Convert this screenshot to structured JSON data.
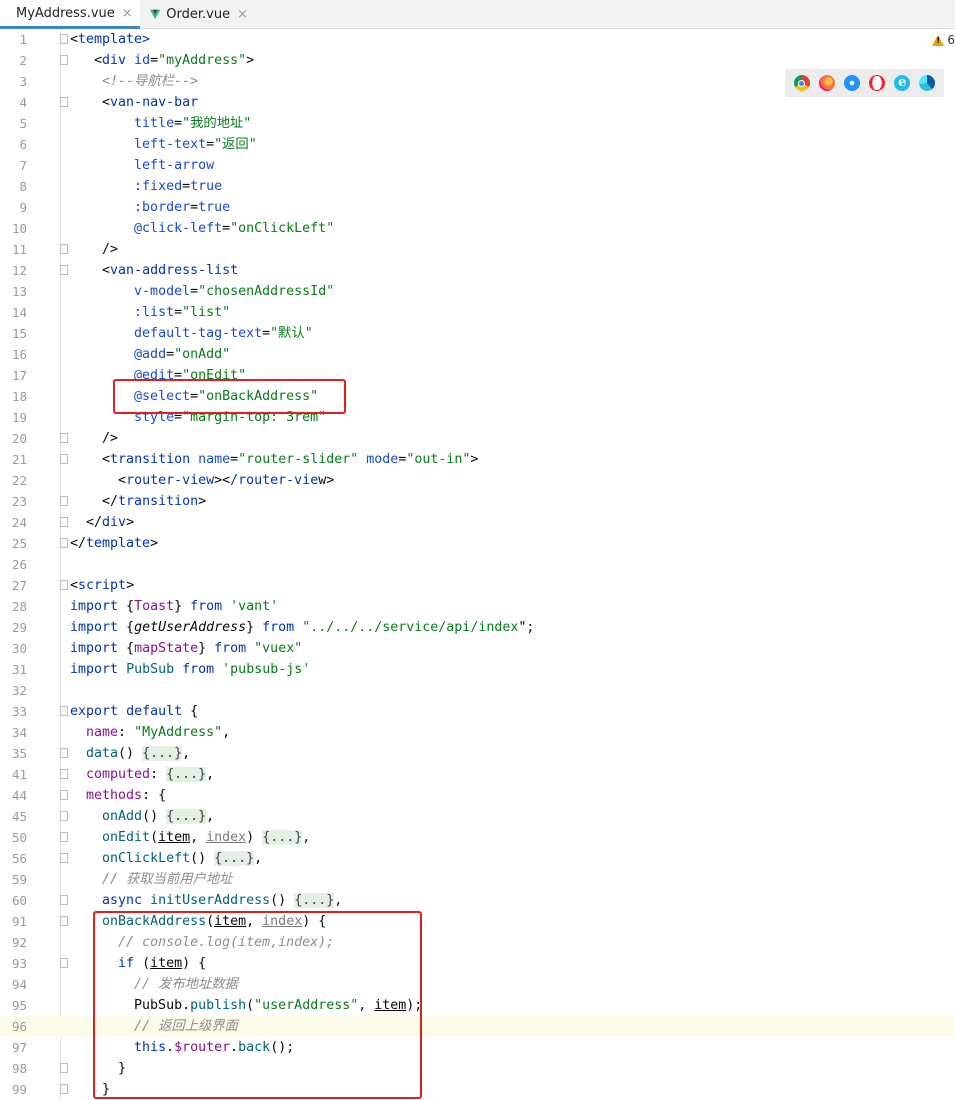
{
  "tabs": [
    {
      "label": "MyAddress.vue",
      "close": "×"
    },
    {
      "label": "Order.vue",
      "close": "×"
    }
  ],
  "warning_count": "6",
  "browser_icons": [
    "chrome-icon",
    "firefox-icon",
    "safari-icon",
    "opera-icon",
    "ie-icon",
    "edge-icon"
  ],
  "colors": {
    "accent": "#4083c9",
    "highlight_box": "#e0201f",
    "vue_logo": "#41b883"
  },
  "code_lines": [
    {
      "n": "1",
      "text": "<template>"
    },
    {
      "n": "2",
      "text": "  <div id=\"myAddress\">"
    },
    {
      "n": "3",
      "text": "    <!--导航栏-->"
    },
    {
      "n": "4",
      "text": "    <van-nav-bar"
    },
    {
      "n": "5",
      "text": "        title=\"我的地址\""
    },
    {
      "n": "6",
      "text": "        left-text=\"返回\""
    },
    {
      "n": "7",
      "text": "        left-arrow"
    },
    {
      "n": "8",
      "text": "        :fixed=true"
    },
    {
      "n": "9",
      "text": "        :border=true"
    },
    {
      "n": "10",
      "text": "        @click-left=\"onClickLeft\""
    },
    {
      "n": "11",
      "text": "    />"
    },
    {
      "n": "12",
      "text": "    <van-address-list"
    },
    {
      "n": "13",
      "text": "        v-model=\"chosenAddressId\""
    },
    {
      "n": "14",
      "text": "        :list=\"list\""
    },
    {
      "n": "15",
      "text": "        default-tag-text=\"默认\""
    },
    {
      "n": "16",
      "text": "        @add=\"onAdd\""
    },
    {
      "n": "17",
      "text": "        @edit=\"onEdit\""
    },
    {
      "n": "18",
      "text": "        @select=\"onBackAddress\""
    },
    {
      "n": "19",
      "text": "        style=\"margin-top: 3rem\""
    },
    {
      "n": "20",
      "text": "    />"
    },
    {
      "n": "21",
      "text": "    <transition name=\"router-slider\" mode=\"out-in\">"
    },
    {
      "n": "22",
      "text": "      <router-view></router-view>"
    },
    {
      "n": "23",
      "text": "    </transition>"
    },
    {
      "n": "24",
      "text": "  </div>"
    },
    {
      "n": "25",
      "text": "</template>"
    },
    {
      "n": "26",
      "text": ""
    },
    {
      "n": "27",
      "text": "<script>"
    },
    {
      "n": "28",
      "text": "import {Toast} from 'vant'"
    },
    {
      "n": "29",
      "text": "import {getUserAddress} from \"../../../service/api/index\";"
    },
    {
      "n": "30",
      "text": "import {mapState} from \"vuex\""
    },
    {
      "n": "31",
      "text": "import PubSub from 'pubsub-js'"
    },
    {
      "n": "32",
      "text": ""
    },
    {
      "n": "33",
      "text": "export default {"
    },
    {
      "n": "34",
      "text": "  name: \"MyAddress\","
    },
    {
      "n": "35",
      "text": "  data() {...},"
    },
    {
      "n": "41",
      "text": "  computed: {...},"
    },
    {
      "n": "44",
      "text": "  methods: {"
    },
    {
      "n": "45",
      "text": "    onAdd() {...},"
    },
    {
      "n": "50",
      "text": "    onEdit(item, index) {...},"
    },
    {
      "n": "56",
      "text": "    onClickLeft() {...},"
    },
    {
      "n": "59",
      "text": "    // 获取当前用户地址"
    },
    {
      "n": "60",
      "text": "    async initUserAddress() {...},"
    },
    {
      "n": "91",
      "text": "    onBackAddress(item, index) {"
    },
    {
      "n": "92",
      "text": "      // console.log(item,index);"
    },
    {
      "n": "93",
      "text": "      if (item) {"
    },
    {
      "n": "94",
      "text": "        // 发布地址数据"
    },
    {
      "n": "95",
      "text": "        PubSub.publish(\"userAddress\", item);"
    },
    {
      "n": "96",
      "text": "        // 返回上级界面"
    },
    {
      "n": "97",
      "text": "        this.$router.back();"
    },
    {
      "n": "98",
      "text": "      }"
    },
    {
      "n": "99",
      "text": "    }"
    }
  ]
}
